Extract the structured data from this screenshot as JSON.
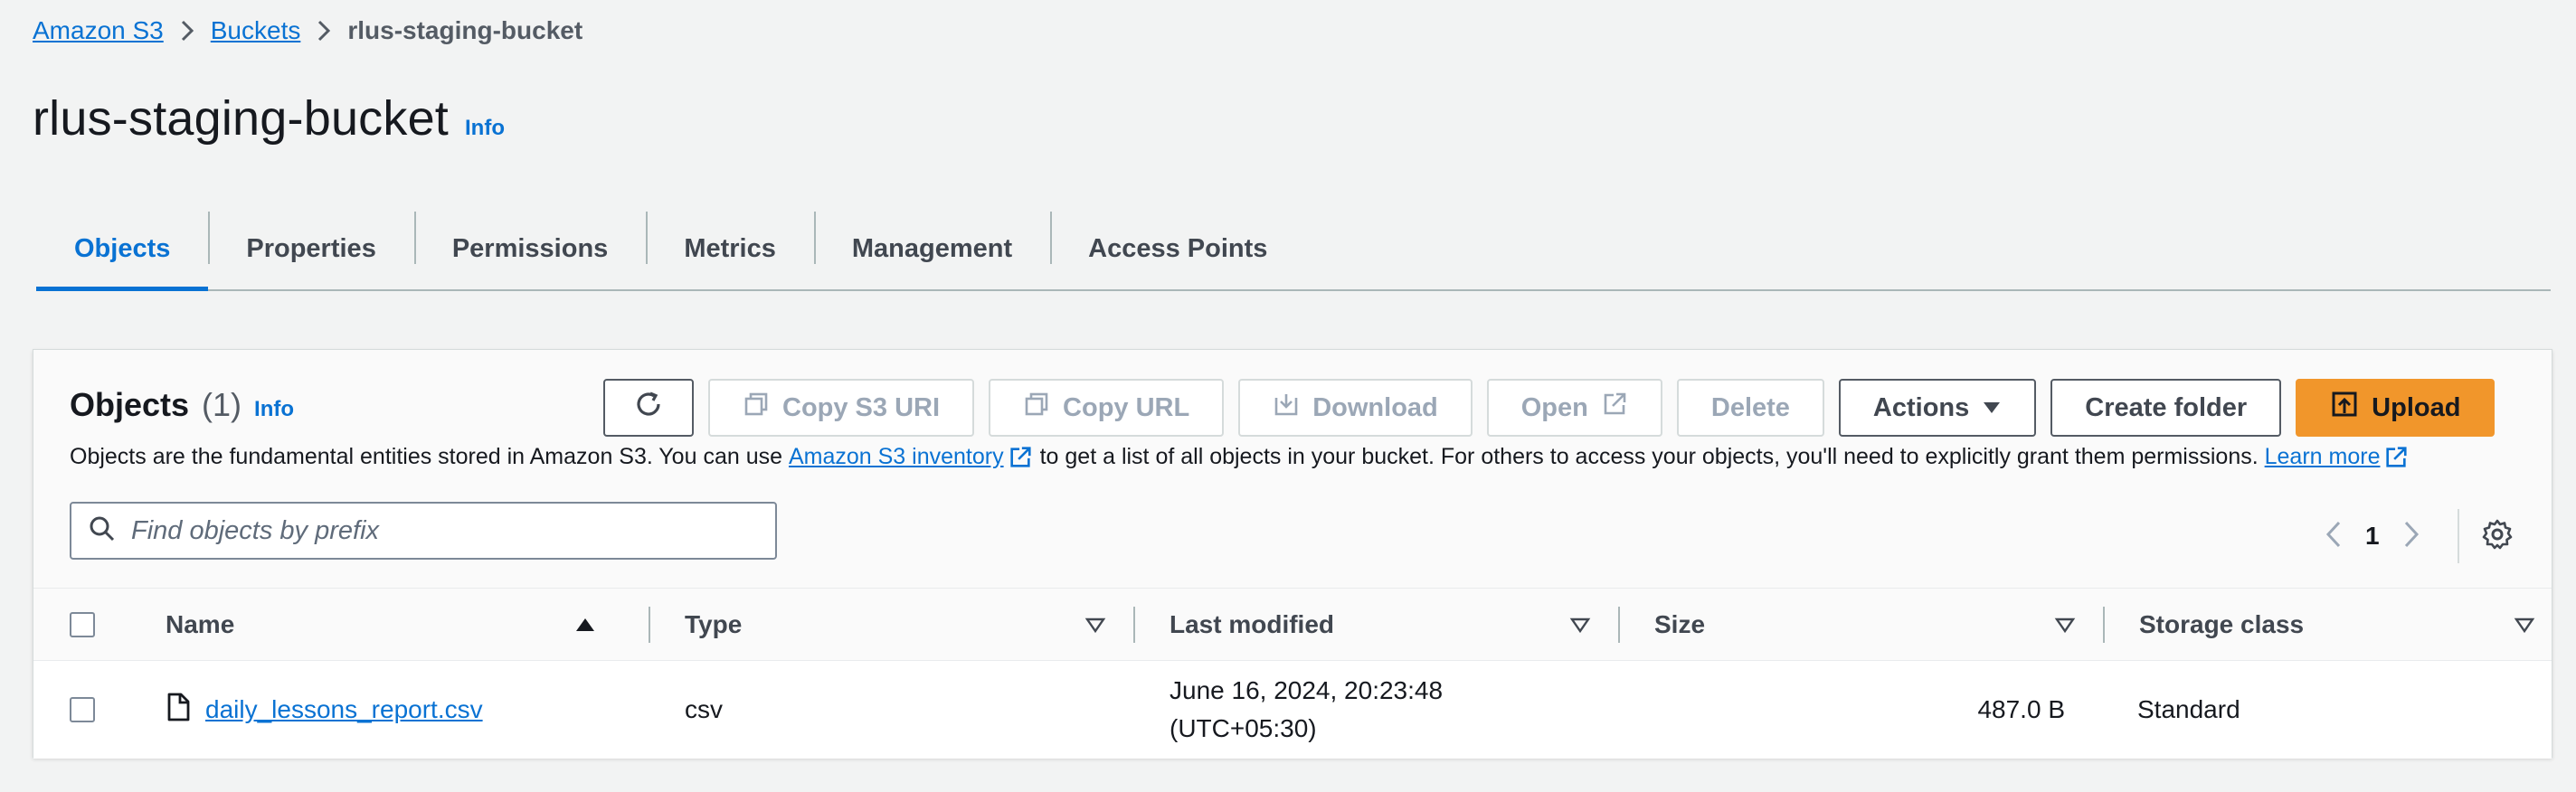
{
  "breadcrumb": {
    "items": [
      "Amazon S3",
      "Buckets"
    ],
    "current": "rlus-staging-bucket"
  },
  "page": {
    "title": "rlus-staging-bucket",
    "info": "Info"
  },
  "tabs": [
    "Objects",
    "Properties",
    "Permissions",
    "Metrics",
    "Management",
    "Access Points"
  ],
  "active_tab": "Objects",
  "objects_panel": {
    "title": "Objects",
    "count": "(1)",
    "info": "Info",
    "description_before": "Objects are the fundamental entities stored in Amazon S3. You can use",
    "inventory_link": "Amazon S3 inventory",
    "description_middle": "to get a list of all objects in your bucket. For others to access your objects, you'll need to explicitly grant them permissions.",
    "learn_more": "Learn more",
    "toolbar": {
      "copy_s3_uri": "Copy S3 URI",
      "copy_url": "Copy URL",
      "download": "Download",
      "open": "Open",
      "delete": "Delete",
      "actions": "Actions",
      "create_folder": "Create folder",
      "upload": "Upload"
    },
    "search_placeholder": "Find objects by prefix",
    "current_page": "1"
  },
  "table": {
    "columns": [
      "Name",
      "Type",
      "Last modified",
      "Size",
      "Storage class"
    ],
    "rows": [
      {
        "name": "daily_lessons_report.csv",
        "type": "csv",
        "last_modified_line1": "June 16, 2024, 20:23:48",
        "last_modified_line2": "(UTC+05:30)",
        "size": "487.0 B",
        "storage_class": "Standard"
      }
    ]
  },
  "colors": {
    "link": "#0972d3",
    "primary_button": "#f1962b",
    "background": "#f2f3f3"
  }
}
